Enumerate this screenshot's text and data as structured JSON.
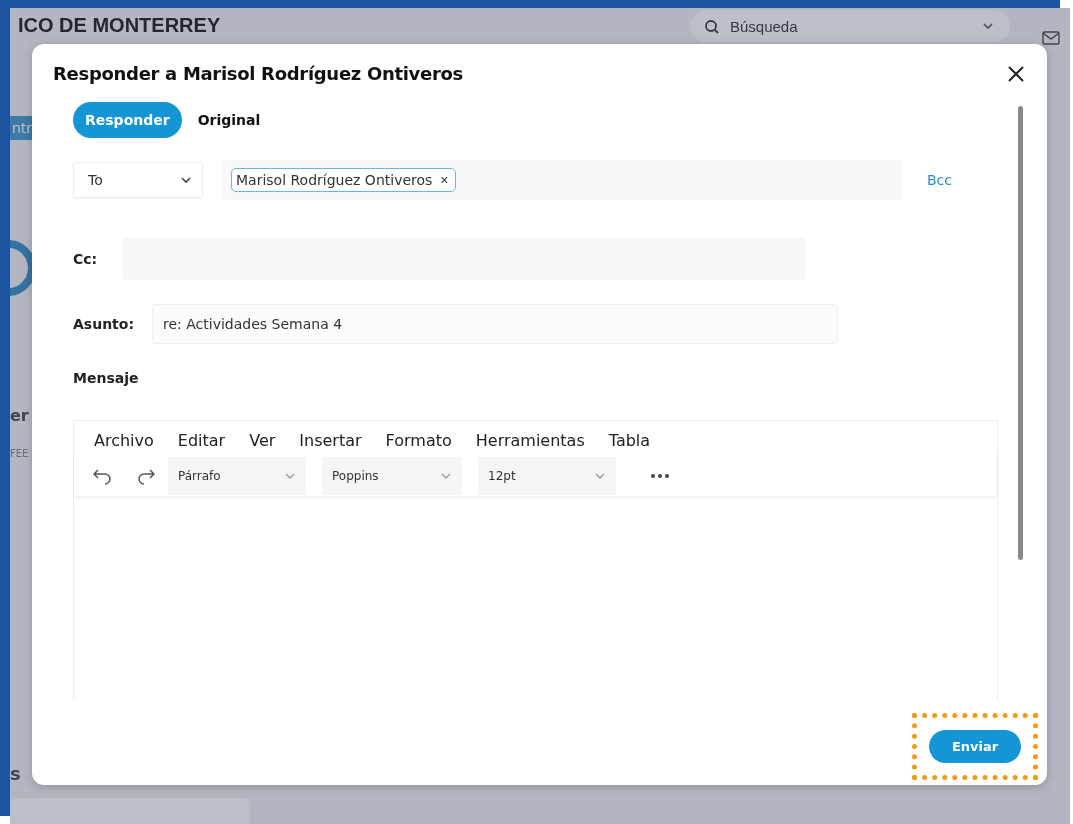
{
  "background": {
    "title": "ICO DE MONTERREY",
    "search": {
      "placeholder": "Búsqueda"
    },
    "fragments": [
      "ntr",
      "er",
      "FEE",
      "s"
    ]
  },
  "dialog": {
    "title": "Responder a Marisol Rodríguez Ontiveros",
    "tabs": [
      {
        "label": "Responder",
        "selected": true
      },
      {
        "label": "Original",
        "selected": false
      }
    ],
    "recipient_type": "To",
    "recipients": [
      {
        "name": "Marisol Rodríguez Ontiveros",
        "remove": "×"
      }
    ],
    "bcc_link": "Bcc",
    "cc": {
      "label": "Cc:"
    },
    "subject": {
      "label": "Asunto:",
      "value": "re: Actividades Semana 4"
    },
    "message_label": "Mensaje",
    "editor": {
      "menu": [
        "Archivo",
        "Editar",
        "Ver",
        "Insertar",
        "Formato",
        "Herramientas",
        "Tabla"
      ],
      "block_format": "Párrafo",
      "font": "Poppins",
      "font_size": "12pt"
    },
    "send_button": {
      "label": "Enviar",
      "highlighted": true
    }
  }
}
